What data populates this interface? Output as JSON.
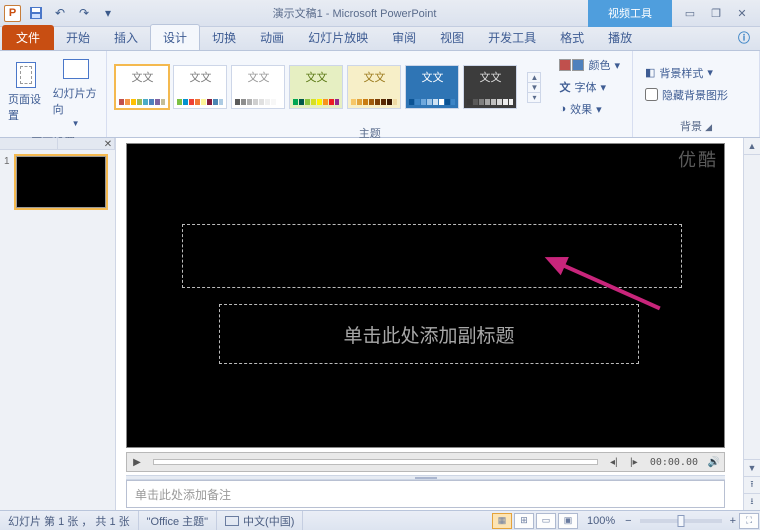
{
  "titlebar": {
    "title": "演示文稿1 - Microsoft PowerPoint",
    "context_tool": "视频工具",
    "app_letter": "P"
  },
  "tabs": {
    "file": "文件",
    "home": "开始",
    "insert": "插入",
    "design": "设计",
    "transitions": "切换",
    "animations": "动画",
    "slideshow": "幻灯片放映",
    "review": "审阅",
    "view": "视图",
    "developer": "开发工具",
    "format": "格式",
    "playback": "播放",
    "help": ""
  },
  "ribbon": {
    "page_setup_group": "页面设置",
    "page_setup": "页面设置",
    "slide_orientation": "幻灯片方向",
    "themes_group": "主题",
    "theme_label": "文文",
    "colors": "颜色",
    "fonts": "字体",
    "effects": "效果",
    "bg_group": "背景",
    "bg_styles": "背景样式",
    "hide_bg": "隐藏背景图形"
  },
  "slide": {
    "watermark": "优酷",
    "subtitle_ph": "单击此处添加副标题",
    "notes_ph": "单击此处添加备注"
  },
  "play": {
    "time": "00:00.00"
  },
  "status": {
    "slide_info": "幻灯片 第 1 张 ， 共 1 张",
    "theme": "\"Office 主题\"",
    "lang": "中文(中国)",
    "zoom": "100%"
  },
  "thumb": {
    "num": "1"
  },
  "theme_palettes": [
    [
      "#c0504d",
      "#f79646",
      "#ffc000",
      "#9bbb59",
      "#4bacc6",
      "#4f81bd",
      "#8064a2",
      "#c4bd97"
    ],
    [
      "#7bc043",
      "#0392cf",
      "#ee4035",
      "#f37736",
      "#fdf498",
      "#851e3e",
      "#4b86b4",
      "#adcbe3"
    ],
    [
      "#5b5b5b",
      "#8e8e8e",
      "#b0b0b0",
      "#cfcfcf",
      "#e0e0e0",
      "#efefef",
      "#f7f7f7",
      "#ffffff"
    ],
    [
      "#00a651",
      "#00584a",
      "#8dc63f",
      "#d7df23",
      "#fff200",
      "#f7941d",
      "#ed1c24",
      "#92278f"
    ],
    [
      "#f6c667",
      "#e2a33b",
      "#c97d13",
      "#a05a0c",
      "#7c3f07",
      "#5a2a04",
      "#3d1a02",
      "#eed9a3"
    ],
    [
      "#0b5394",
      "#3d85c6",
      "#6fa8dc",
      "#9fc5e8",
      "#cfe2f3",
      "#fff",
      "#0b5394",
      "#3d85c6"
    ],
    [
      "#393939",
      "#595959",
      "#7f7f7f",
      "#a5a5a5",
      "#bfbfbf",
      "#d8d8d8",
      "#ececec",
      "#f2f2f2"
    ]
  ],
  "theme_bg": [
    "#fff",
    "#fff",
    "#fff",
    "#e6efc2",
    "#f7efc8",
    "#2f75b5",
    "#3c3c3c"
  ],
  "theme_txtcolor": [
    "#7d7d7d",
    "#7d7d7d",
    "#9a9a9a",
    "#5a7814",
    "#9c7b1e",
    "#fff",
    "#ddd"
  ]
}
